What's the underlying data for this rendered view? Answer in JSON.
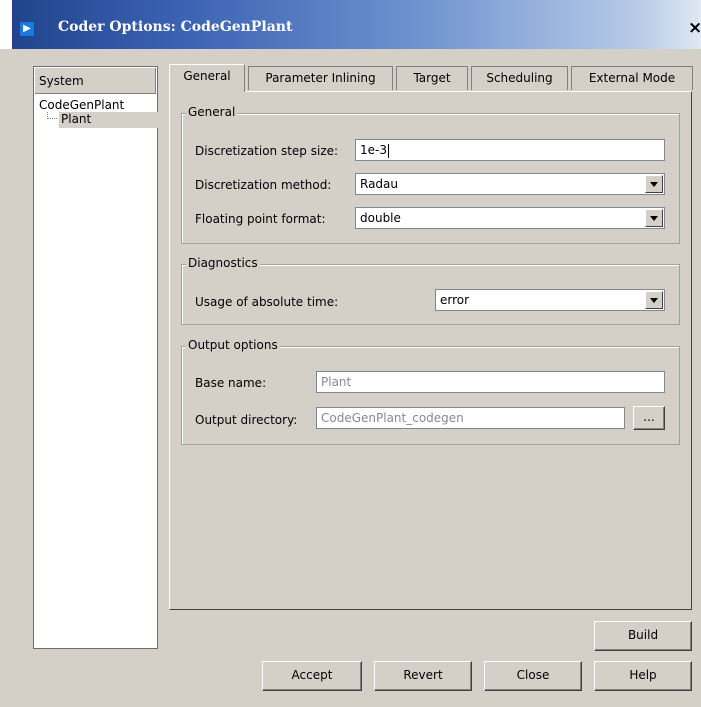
{
  "window": {
    "title": "Coder Options: CodeGenPlant",
    "close_glyph": "×",
    "icon": "play-icon"
  },
  "tree": {
    "header": "System",
    "root": "CodeGenPlant",
    "child": "Plant"
  },
  "tabs": [
    "General",
    "Parameter Inlining",
    "Target",
    "Scheduling",
    "External Mode"
  ],
  "general_group": {
    "title": "General",
    "step_size_label": "Discretization step size:",
    "step_size_value": "1e-3",
    "method_label": "Discretization method:",
    "method_value": "Radau",
    "float_label": "Floating point format:",
    "float_value": "double"
  },
  "diagnostics_group": {
    "title": "Diagnostics",
    "abs_time_label": "Usage of absolute time:",
    "abs_time_value": "error"
  },
  "output_group": {
    "title": "Output options",
    "base_name_label": "Base name:",
    "base_name_value": "Plant",
    "output_dir_label": "Output directory:",
    "output_dir_value": "CodeGenPlant_codegen",
    "browse_label": "..."
  },
  "buttons": {
    "build": "Build",
    "accept": "Accept",
    "revert": "Revert",
    "close": "Close",
    "help": "Help"
  }
}
